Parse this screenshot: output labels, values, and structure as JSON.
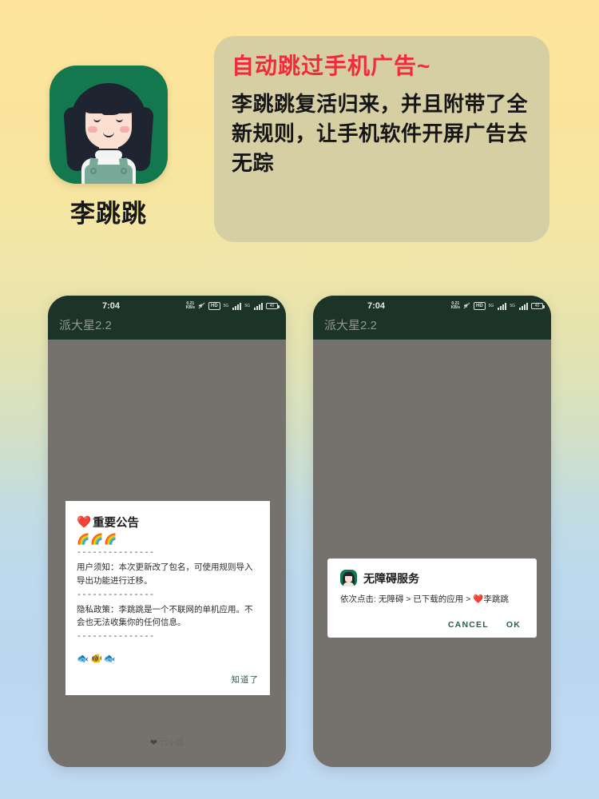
{
  "hero": {
    "app_icon_name": "li-tiao-tiao-app-icon",
    "app_name": "李跳跳",
    "card_title": "自动跳过手机广告~",
    "card_body": "李跳跳复活归来，并且附带了全新规则，让手机软件开屏广告去无踪",
    "title_color": "#ef2b3c",
    "card_bg": "#d7cfa4"
  },
  "phones": [
    {
      "status": {
        "time": "7:04",
        "net_speed": "0.21\nKB/s",
        "mute_icon": "mute-icon",
        "hd_label": "HD",
        "sim1_label": "5G",
        "sim2_label": "5G",
        "battery_label": "40"
      },
      "app_title": "派大星2.2",
      "dialog": {
        "heart": "❤️",
        "title": "重要公告",
        "rainbows": "🌈🌈🌈",
        "divider": "---------------",
        "para1": "用户须知：本次更新改了包名，可使用规则导入导出功能进行迁移。",
        "para2": "隐私政策：李跳跳是一个不联网的单机应用。不会也无法收集你的任何信息。",
        "fish": "🐟🐠🐟",
        "action_label": "知道了",
        "action_color": "#2e5a4a"
      },
      "watermark": {
        "heart": "❤",
        "text": "六小姐"
      }
    },
    {
      "status": {
        "time": "7:04",
        "net_speed": "0.21\nKB/s",
        "mute_icon": "mute-icon",
        "hd_label": "HD",
        "sim1_label": "5G",
        "sim2_label": "5G",
        "battery_label": "40"
      },
      "app_title": "派大星2.2",
      "dialog": {
        "icon_name": "li-tiao-tiao-mini-icon",
        "title": "无障碍服务",
        "message": "依次点击: 无障碍 > 已下载的应用 > ❤️李跳跳",
        "cancel_label": "CANCEL",
        "ok_label": "OK",
        "action_color": "#2e5a4a"
      }
    }
  ],
  "colors": {
    "bg_top": "#fde49a",
    "bg_bottom": "#c0daf2",
    "phone_body": "#75726d",
    "phone_header": "#1b3328",
    "icon_green": "#14784f"
  }
}
